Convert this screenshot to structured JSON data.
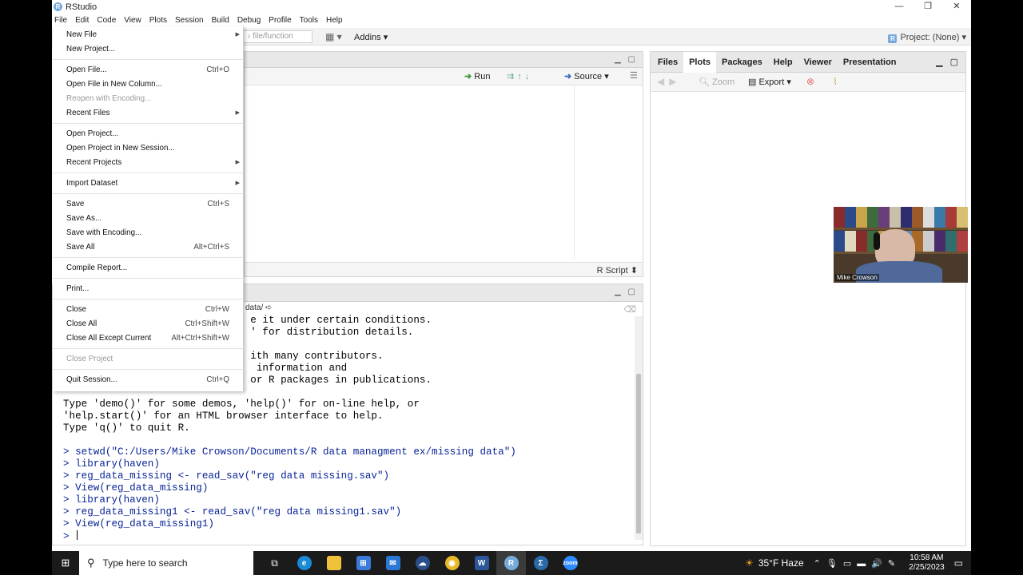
{
  "window": {
    "title": "RStudio",
    "controls": [
      "—",
      "❐",
      "✕"
    ]
  },
  "menubar": [
    "File",
    "Edit",
    "Code",
    "View",
    "Plots",
    "Session",
    "Build",
    "Debug",
    "Profile",
    "Tools",
    "Help"
  ],
  "toolbar": {
    "goto_placeholder": "› file/function",
    "addins": "Addins",
    "project": "Project: (None)"
  },
  "source_pane": {
    "run": "Run",
    "source": "Source",
    "file_type": "R Script"
  },
  "console_pane": {
    "path": "data/",
    "lines": [
      {
        "text": "                               e it under certain conditions.",
        "cmd": false
      },
      {
        "text": "                               ' for distribution details.",
        "cmd": false
      },
      {
        "text": "",
        "cmd": false
      },
      {
        "text": "                               ith many contributors.",
        "cmd": false
      },
      {
        "text": "                                information and",
        "cmd": false
      },
      {
        "text": "                               or R packages in publications.",
        "cmd": false
      },
      {
        "text": "",
        "cmd": false
      },
      {
        "text": "Type 'demo()' for some demos, 'help()' for on-line help, or",
        "cmd": false
      },
      {
        "text": "'help.start()' for an HTML browser interface to help.",
        "cmd": false
      },
      {
        "text": "Type 'q()' to quit R.",
        "cmd": false
      },
      {
        "text": "",
        "cmd": false
      },
      {
        "text": "> setwd(\"C:/Users/Mike Crowson/Documents/R data managment ex/missing data\")",
        "cmd": true
      },
      {
        "text": "> library(haven)",
        "cmd": true
      },
      {
        "text": "> reg_data_missing <- read_sav(\"reg data missing.sav\")",
        "cmd": true
      },
      {
        "text": "> View(reg_data_missing)",
        "cmd": true
      },
      {
        "text": "> library(haven)",
        "cmd": true
      },
      {
        "text": "> reg_data_missing1 <- read_sav(\"reg data missing1.sav\")",
        "cmd": true
      },
      {
        "text": "> View(reg_data_missing1)",
        "cmd": true
      }
    ],
    "prompt": "> "
  },
  "right_pane": {
    "tabs": [
      "Files",
      "Plots",
      "Packages",
      "Help",
      "Viewer",
      "Presentation"
    ],
    "active_tab": "Plots",
    "zoom": "Zoom",
    "export": "Export"
  },
  "file_menu": [
    {
      "label": "New File",
      "shortcut": "",
      "submenu": true,
      "disabled": false
    },
    {
      "label": "New Project...",
      "shortcut": "",
      "submenu": false,
      "disabled": false
    },
    {
      "sep": true
    },
    {
      "label": "Open File...",
      "shortcut": "Ctrl+O",
      "submenu": false,
      "disabled": false
    },
    {
      "label": "Open File in New Column...",
      "shortcut": "",
      "submenu": false,
      "disabled": false
    },
    {
      "label": "Reopen with Encoding...",
      "shortcut": "",
      "submenu": false,
      "disabled": true
    },
    {
      "label": "Recent Files",
      "shortcut": "",
      "submenu": true,
      "disabled": false
    },
    {
      "sep": true
    },
    {
      "label": "Open Project...",
      "shortcut": "",
      "submenu": false,
      "disabled": false
    },
    {
      "label": "Open Project in New Session...",
      "shortcut": "",
      "submenu": false,
      "disabled": false
    },
    {
      "label": "Recent Projects",
      "shortcut": "",
      "submenu": true,
      "disabled": false
    },
    {
      "sep": true
    },
    {
      "label": "Import Dataset",
      "shortcut": "",
      "submenu": true,
      "disabled": false
    },
    {
      "sep": true
    },
    {
      "label": "Save",
      "shortcut": "Ctrl+S",
      "submenu": false,
      "disabled": false
    },
    {
      "label": "Save As...",
      "shortcut": "",
      "submenu": false,
      "disabled": false
    },
    {
      "label": "Save with Encoding...",
      "shortcut": "",
      "submenu": false,
      "disabled": false
    },
    {
      "label": "Save All",
      "shortcut": "Alt+Ctrl+S",
      "submenu": false,
      "disabled": false
    },
    {
      "sep": true
    },
    {
      "label": "Compile Report...",
      "shortcut": "",
      "submenu": false,
      "disabled": false
    },
    {
      "sep": true
    },
    {
      "label": "Print...",
      "shortcut": "",
      "submenu": false,
      "disabled": false
    },
    {
      "sep": true
    },
    {
      "label": "Close",
      "shortcut": "Ctrl+W",
      "submenu": false,
      "disabled": false
    },
    {
      "label": "Close All",
      "shortcut": "Ctrl+Shift+W",
      "submenu": false,
      "disabled": false
    },
    {
      "label": "Close All Except Current",
      "shortcut": "Alt+Ctrl+Shift+W",
      "submenu": false,
      "disabled": false
    },
    {
      "sep": true
    },
    {
      "label": "Close Project",
      "shortcut": "",
      "submenu": false,
      "disabled": true
    },
    {
      "sep": true
    },
    {
      "label": "Quit Session...",
      "shortcut": "Ctrl+Q",
      "submenu": false,
      "disabled": false
    }
  ],
  "webcam": {
    "name": "Mike Crowson"
  },
  "taskbar": {
    "search_placeholder": "Type here to search",
    "weather": "35°F  Haze",
    "time": "10:58 AM",
    "date": "2/25/2023"
  }
}
